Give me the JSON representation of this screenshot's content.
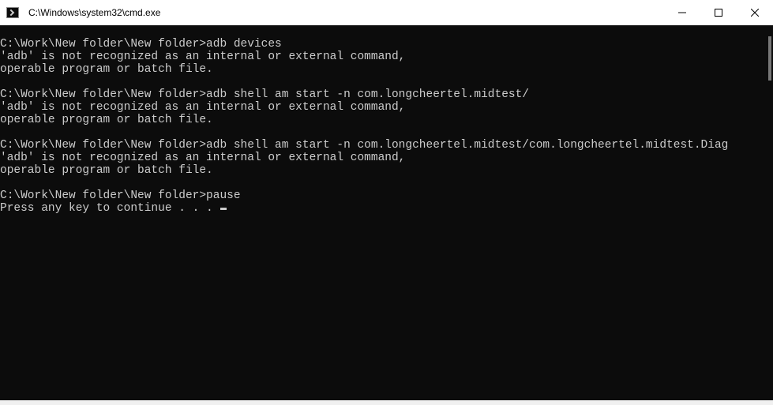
{
  "titlebar": {
    "title": "C:\\Windows\\system32\\cmd.exe"
  },
  "terminal": {
    "lines": [
      "",
      "C:\\Work\\New folder\\New folder>adb devices",
      "'adb' is not recognized as an internal or external command,",
      "operable program or batch file.",
      "",
      "C:\\Work\\New folder\\New folder>adb shell am start -n com.longcheertel.midtest/",
      "'adb' is not recognized as an internal or external command,",
      "operable program or batch file.",
      "",
      "C:\\Work\\New folder\\New folder>adb shell am start -n com.longcheertel.midtest/com.longcheertel.midtest.Diag",
      "'adb' is not recognized as an internal or external command,",
      "operable program or batch file.",
      "",
      "C:\\Work\\New folder\\New folder>pause",
      "Press any key to continue . . . "
    ]
  }
}
